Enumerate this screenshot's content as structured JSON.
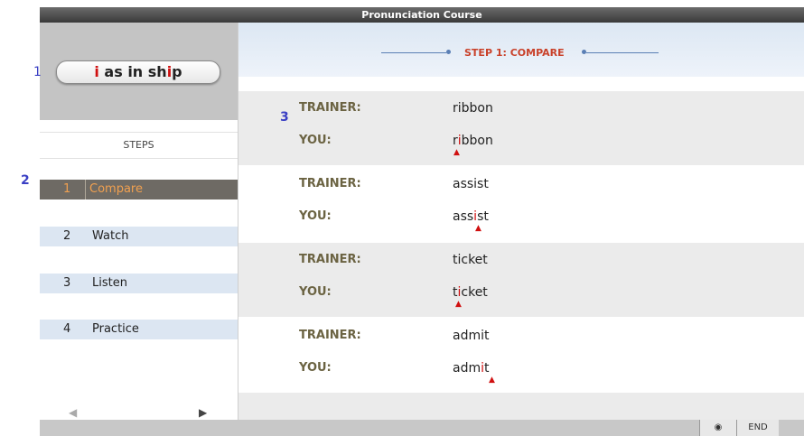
{
  "window": {
    "title": "Pronunciation Course"
  },
  "annotations": {
    "a1": "1",
    "a2": "2",
    "a3": "3"
  },
  "sound": {
    "pre": "i",
    "mid": " as in sh",
    "hl": "i",
    "post": "p"
  },
  "steps": {
    "header": "STEPS",
    "items": [
      {
        "num": "1",
        "label": "Compare",
        "active": true
      },
      {
        "num": "2",
        "label": "Watch",
        "active": false
      },
      {
        "num": "3",
        "label": "Listen",
        "active": false
      },
      {
        "num": "4",
        "label": "Practice",
        "active": false
      }
    ],
    "prev_icon": "left-arrow-icon",
    "next_icon": "right-arrow-icon"
  },
  "main": {
    "step_label": "STEP 1",
    "step_name": ": COMPARE",
    "trainer_label": "TRAINER:",
    "you_label": "YOU:",
    "pairs": [
      {
        "trainer": "ribbon",
        "you_pre": "r",
        "you_hl": "i",
        "you_post": "bbon"
      },
      {
        "trainer": "assist",
        "you_pre": "ass",
        "you_hl": "i",
        "you_post": "st"
      },
      {
        "trainer": "ticket",
        "you_pre": "t",
        "you_hl": "i",
        "you_post": "cket"
      },
      {
        "trainer": "admit",
        "you_pre": "adm",
        "you_hl": "i",
        "you_post": "t"
      }
    ]
  },
  "footer": {
    "globe_icon": "globe-icon",
    "end_label": "END"
  },
  "colors": {
    "accent": "#d01010",
    "active_step_bg": "#6e6a64",
    "step_bg": "#dce6f2"
  }
}
